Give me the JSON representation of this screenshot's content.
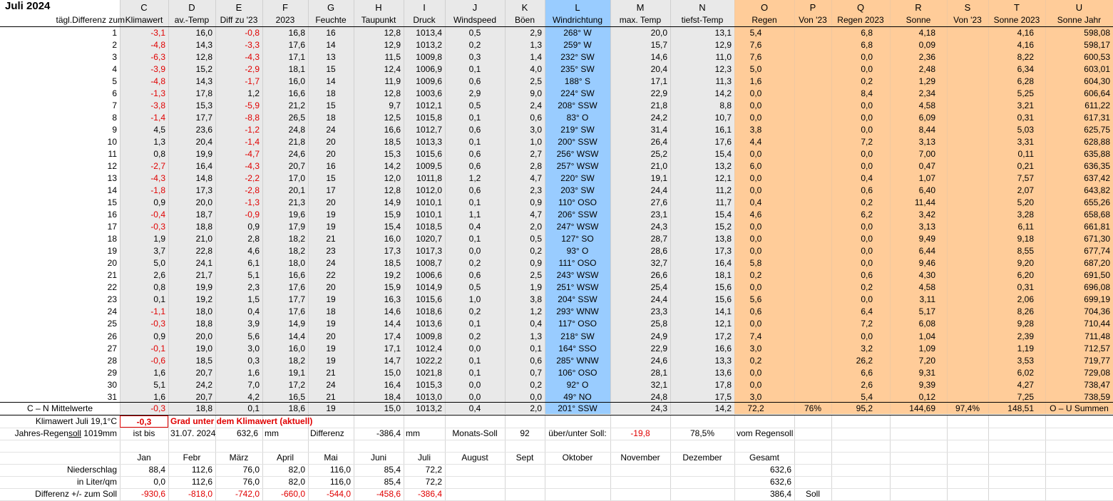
{
  "title": "Juli 2024",
  "row_label_header": "tägl.Differenz zum",
  "columns": [
    {
      "letter": "C",
      "name": "Klimawert"
    },
    {
      "letter": "D",
      "name": "av.-Temp"
    },
    {
      "letter": "E",
      "name": "Diff zu '23"
    },
    {
      "letter": "F",
      "name": "2023"
    },
    {
      "letter": "G",
      "name": "Feuchte"
    },
    {
      "letter": "H",
      "name": "Taupunkt"
    },
    {
      "letter": "I",
      "name": "Druck"
    },
    {
      "letter": "J",
      "name": "Windspeed"
    },
    {
      "letter": "K",
      "name": "Böen"
    },
    {
      "letter": "L",
      "name": "Windrichtung"
    },
    {
      "letter": "M",
      "name": "max. Temp"
    },
    {
      "letter": "N",
      "name": "tiefst-Temp"
    },
    {
      "letter": "O",
      "name": "Regen"
    },
    {
      "letter": "P",
      "name": "Von '23"
    },
    {
      "letter": "Q",
      "name": "Regen 2023"
    },
    {
      "letter": "R",
      "name": "Sonne"
    },
    {
      "letter": "S",
      "name": "Von '23"
    },
    {
      "letter": "T",
      "name": "Sonne 2023"
    },
    {
      "letter": "U",
      "name": "Sonne Jahr"
    }
  ],
  "rows": [
    {
      "day": "1",
      "c": "-3,1",
      "d": "16,0",
      "e": "-0,8",
      "f": "16,8",
      "g": "16",
      "h": "12,8",
      "i": "1013,4",
      "j": "0,5",
      "k": "2,9",
      "l": "268° W",
      "m": "20,0",
      "n": "13,1",
      "o": "5,4",
      "p": "",
      "q": "6,8",
      "r": "4,18",
      "s": "",
      "t": "4,16",
      "u": "598,08"
    },
    {
      "day": "2",
      "c": "-4,8",
      "d": "14,3",
      "e": "-3,3",
      "f": "17,6",
      "g": "14",
      "h": "12,9",
      "i": "1013,2",
      "j": "0,2",
      "k": "1,3",
      "l": "259° W",
      "m": "15,7",
      "n": "12,9",
      "o": "7,6",
      "p": "",
      "q": "6,8",
      "r": "0,09",
      "s": "",
      "t": "4,16",
      "u": "598,17"
    },
    {
      "day": "3",
      "c": "-6,3",
      "d": "12,8",
      "e": "-4,3",
      "f": "17,1",
      "g": "13",
      "h": "11,5",
      "i": "1009,8",
      "j": "0,3",
      "k": "1,4",
      "l": "232° SW",
      "m": "14,6",
      "n": "11,0",
      "o": "7,6",
      "p": "",
      "q": "0,0",
      "r": "2,36",
      "s": "",
      "t": "8,22",
      "u": "600,53"
    },
    {
      "day": "4",
      "c": "-3,9",
      "d": "15,2",
      "e": "-2,9",
      "f": "18,1",
      "g": "15",
      "h": "12,4",
      "i": "1006,9",
      "j": "0,1",
      "k": "4,0",
      "l": "235° SW",
      "m": "20,4",
      "n": "12,3",
      "o": "5,0",
      "p": "",
      "q": "0,0",
      "r": "2,48",
      "s": "",
      "t": "6,34",
      "u": "603,01"
    },
    {
      "day": "5",
      "c": "-4,8",
      "d": "14,3",
      "e": "-1,7",
      "f": "16,0",
      "g": "14",
      "h": "11,9",
      "i": "1009,6",
      "j": "0,6",
      "k": "2,5",
      "l": "188° S",
      "m": "17,1",
      "n": "11,3",
      "o": "1,6",
      "p": "",
      "q": "0,2",
      "r": "1,29",
      "s": "",
      "t": "6,28",
      "u": "604,30"
    },
    {
      "day": "6",
      "c": "-1,3",
      "d": "17,8",
      "e": "1,2",
      "f": "16,6",
      "g": "18",
      "h": "12,8",
      "i": "1003,6",
      "j": "2,9",
      "k": "9,0",
      "l": "224° SW",
      "m": "22,9",
      "n": "14,2",
      "o": "0,0",
      "p": "",
      "q": "8,4",
      "r": "2,34",
      "s": "",
      "t": "5,25",
      "u": "606,64"
    },
    {
      "day": "7",
      "c": "-3,8",
      "d": "15,3",
      "e": "-5,9",
      "f": "21,2",
      "g": "15",
      "h": "9,7",
      "i": "1012,1",
      "j": "0,5",
      "k": "2,4",
      "l": "208° SSW",
      "m": "21,8",
      "n": "8,8",
      "o": "0,0",
      "p": "",
      "q": "0,0",
      "r": "4,58",
      "s": "",
      "t": "3,21",
      "u": "611,22"
    },
    {
      "day": "8",
      "c": "-1,4",
      "d": "17,7",
      "e": "-8,8",
      "f": "26,5",
      "g": "18",
      "h": "12,5",
      "i": "1015,8",
      "j": "0,1",
      "k": "0,6",
      "l": "83° O",
      "m": "24,2",
      "n": "10,7",
      "o": "0,0",
      "p": "",
      "q": "0,0",
      "r": "6,09",
      "s": "",
      "t": "0,31",
      "u": "617,31"
    },
    {
      "day": "9",
      "c": "4,5",
      "d": "23,6",
      "e": "-1,2",
      "f": "24,8",
      "g": "24",
      "h": "16,6",
      "i": "1012,7",
      "j": "0,6",
      "k": "3,0",
      "l": "219° SW",
      "m": "31,4",
      "n": "16,1",
      "o": "3,8",
      "p": "",
      "q": "0,0",
      "r": "8,44",
      "s": "",
      "t": "5,03",
      "u": "625,75"
    },
    {
      "day": "10",
      "c": "1,3",
      "d": "20,4",
      "e": "-1,4",
      "f": "21,8",
      "g": "20",
      "h": "18,5",
      "i": "1013,3",
      "j": "0,1",
      "k": "1,0",
      "l": "200° SSW",
      "m": "26,4",
      "n": "17,6",
      "o": "4,4",
      "p": "",
      "q": "7,2",
      "r": "3,13",
      "s": "",
      "t": "3,31",
      "u": "628,88"
    },
    {
      "day": "11",
      "c": "0,8",
      "d": "19,9",
      "e": "-4,7",
      "f": "24,6",
      "g": "20",
      "h": "15,3",
      "i": "1015,6",
      "j": "0,6",
      "k": "2,7",
      "l": "256° WSW",
      "m": "25,2",
      "n": "15,4",
      "o": "0,0",
      "p": "",
      "q": "0,0",
      "r": "7,00",
      "s": "",
      "t": "0,11",
      "u": "635,88"
    },
    {
      "day": "12",
      "c": "-2,7",
      "d": "16,4",
      "e": "-4,3",
      "f": "20,7",
      "g": "16",
      "h": "14,2",
      "i": "1009,5",
      "j": "0,6",
      "k": "2,8",
      "l": "257° WSW",
      "m": "21,0",
      "n": "13,2",
      "o": "6,0",
      "p": "",
      "q": "0,0",
      "r": "0,47",
      "s": "",
      "t": "0,21",
      "u": "636,35"
    },
    {
      "day": "13",
      "c": "-4,3",
      "d": "14,8",
      "e": "-2,2",
      "f": "17,0",
      "g": "15",
      "h": "12,0",
      "i": "1011,8",
      "j": "1,2",
      "k": "4,7",
      "l": "220° SW",
      "m": "19,1",
      "n": "12,1",
      "o": "0,0",
      "p": "",
      "q": "0,4",
      "r": "1,07",
      "s": "",
      "t": "7,57",
      "u": "637,42"
    },
    {
      "day": "14",
      "c": "-1,8",
      "d": "17,3",
      "e": "-2,8",
      "f": "20,1",
      "g": "17",
      "h": "12,8",
      "i": "1012,0",
      "j": "0,6",
      "k": "2,3",
      "l": "203° SW",
      "m": "24,4",
      "n": "11,2",
      "o": "0,0",
      "p": "",
      "q": "0,6",
      "r": "6,40",
      "s": "",
      "t": "2,07",
      "u": "643,82"
    },
    {
      "day": "15",
      "c": "0,9",
      "d": "20,0",
      "e": "-1,3",
      "f": "21,3",
      "g": "20",
      "h": "14,9",
      "i": "1010,1",
      "j": "0,1",
      "k": "0,9",
      "l": "110° OSO",
      "m": "27,6",
      "n": "11,7",
      "o": "0,4",
      "p": "",
      "q": "0,2",
      "r": "11,44",
      "s": "",
      "t": "5,20",
      "u": "655,26"
    },
    {
      "day": "16",
      "c": "-0,4",
      "d": "18,7",
      "e": "-0,9",
      "f": "19,6",
      "g": "19",
      "h": "15,9",
      "i": "1010,1",
      "j": "1,1",
      "k": "4,7",
      "l": "206° SSW",
      "m": "23,1",
      "n": "15,4",
      "o": "4,6",
      "p": "",
      "q": "6,2",
      "r": "3,42",
      "s": "",
      "t": "3,28",
      "u": "658,68"
    },
    {
      "day": "17",
      "c": "-0,3",
      "d": "18,8",
      "e": "0,9",
      "f": "17,9",
      "g": "19",
      "h": "15,4",
      "i": "1018,5",
      "j": "0,4",
      "k": "2,0",
      "l": "247° WSW",
      "m": "24,3",
      "n": "15,2",
      "o": "0,0",
      "p": "",
      "q": "0,0",
      "r": "3,13",
      "s": "",
      "t": "6,11",
      "u": "661,81"
    },
    {
      "day": "18",
      "c": "1,9",
      "d": "21,0",
      "e": "2,8",
      "f": "18,2",
      "g": "21",
      "h": "16,0",
      "i": "1020,7",
      "j": "0,1",
      "k": "0,5",
      "l": "127° SO",
      "m": "28,7",
      "n": "13,8",
      "o": "0,0",
      "p": "",
      "q": "0,0",
      "r": "9,49",
      "s": "",
      "t": "9,18",
      "u": "671,30"
    },
    {
      "day": "19",
      "c": "3,7",
      "d": "22,8",
      "e": "4,6",
      "f": "18,2",
      "g": "23",
      "h": "17,3",
      "i": "1017,3",
      "j": "0,0",
      "k": "0,2",
      "l": "93° O",
      "m": "28,6",
      "n": "17,3",
      "o": "0,0",
      "p": "",
      "q": "0,0",
      "r": "6,44",
      "s": "",
      "t": "8,55",
      "u": "677,74"
    },
    {
      "day": "20",
      "c": "5,0",
      "d": "24,1",
      "e": "6,1",
      "f": "18,0",
      "g": "24",
      "h": "18,5",
      "i": "1008,7",
      "j": "0,2",
      "k": "0,9",
      "l": "111° OSO",
      "m": "32,7",
      "n": "16,4",
      "o": "5,8",
      "p": "",
      "q": "0,0",
      "r": "9,46",
      "s": "",
      "t": "9,20",
      "u": "687,20"
    },
    {
      "day": "21",
      "c": "2,6",
      "d": "21,7",
      "e": "5,1",
      "f": "16,6",
      "g": "22",
      "h": "19,2",
      "i": "1006,6",
      "j": "0,6",
      "k": "2,5",
      "l": "243° WSW",
      "m": "26,6",
      "n": "18,1",
      "o": "0,2",
      "p": "",
      "q": "0,6",
      "r": "4,30",
      "s": "",
      "t": "6,20",
      "u": "691,50"
    },
    {
      "day": "22",
      "c": "0,8",
      "d": "19,9",
      "e": "2,3",
      "f": "17,6",
      "g": "20",
      "h": "15,9",
      "i": "1014,9",
      "j": "0,5",
      "k": "1,9",
      "l": "251° WSW",
      "m": "25,4",
      "n": "15,6",
      "o": "0,0",
      "p": "",
      "q": "0,2",
      "r": "4,58",
      "s": "",
      "t": "0,31",
      "u": "696,08"
    },
    {
      "day": "23",
      "c": "0,1",
      "d": "19,2",
      "e": "1,5",
      "f": "17,7",
      "g": "19",
      "h": "16,3",
      "i": "1015,6",
      "j": "1,0",
      "k": "3,8",
      "l": "204° SSW",
      "m": "24,4",
      "n": "15,6",
      "o": "5,6",
      "p": "",
      "q": "0,0",
      "r": "3,11",
      "s": "",
      "t": "2,06",
      "u": "699,19"
    },
    {
      "day": "24",
      "c": "-1,1",
      "d": "18,0",
      "e": "0,4",
      "f": "17,6",
      "g": "18",
      "h": "14,6",
      "i": "1018,6",
      "j": "0,2",
      "k": "1,2",
      "l": "293° WNW",
      "m": "23,3",
      "n": "14,1",
      "o": "0,6",
      "p": "",
      "q": "6,4",
      "r": "5,17",
      "s": "",
      "t": "8,26",
      "u": "704,36"
    },
    {
      "day": "25",
      "c": "-0,3",
      "d": "18,8",
      "e": "3,9",
      "f": "14,9",
      "g": "19",
      "h": "14,4",
      "i": "1013,6",
      "j": "0,1",
      "k": "0,4",
      "l": "117° OSO",
      "m": "25,8",
      "n": "12,1",
      "o": "0,0",
      "p": "",
      "q": "7,2",
      "r": "6,08",
      "s": "",
      "t": "9,28",
      "u": "710,44"
    },
    {
      "day": "26",
      "c": "0,9",
      "d": "20,0",
      "e": "5,6",
      "f": "14,4",
      "g": "20",
      "h": "17,4",
      "i": "1009,8",
      "j": "0,2",
      "k": "1,3",
      "l": "218° SW",
      "m": "24,9",
      "n": "17,2",
      "o": "7,4",
      "p": "",
      "q": "0,0",
      "r": "1,04",
      "s": "",
      "t": "2,39",
      "u": "711,48"
    },
    {
      "day": "27",
      "c": "-0,1",
      "d": "19,0",
      "e": "3,0",
      "f": "16,0",
      "g": "19",
      "h": "17,1",
      "i": "1012,4",
      "j": "0,0",
      "k": "0,1",
      "l": "164° SSO",
      "m": "22,9",
      "n": "16,6",
      "o": "3,0",
      "p": "",
      "q": "3,2",
      "r": "1,09",
      "s": "",
      "t": "1,19",
      "u": "712,57"
    },
    {
      "day": "28",
      "c": "-0,6",
      "d": "18,5",
      "e": "0,3",
      "f": "18,2",
      "g": "19",
      "h": "14,7",
      "i": "1022,2",
      "j": "0,1",
      "k": "0,6",
      "l": "285° WNW",
      "m": "24,6",
      "n": "13,3",
      "o": "0,2",
      "p": "",
      "q": "26,2",
      "r": "7,20",
      "s": "",
      "t": "3,53",
      "u": "719,77"
    },
    {
      "day": "29",
      "c": "1,6",
      "d": "20,7",
      "e": "1,6",
      "f": "19,1",
      "g": "21",
      "h": "15,0",
      "i": "1021,8",
      "j": "0,1",
      "k": "0,7",
      "l": "106° OSO",
      "m": "28,1",
      "n": "13,6",
      "o": "0,0",
      "p": "",
      "q": "6,6",
      "r": "9,31",
      "s": "",
      "t": "6,02",
      "u": "729,08"
    },
    {
      "day": "30",
      "c": "5,1",
      "d": "24,2",
      "e": "7,0",
      "f": "17,2",
      "g": "24",
      "h": "16,4",
      "i": "1015,3",
      "j": "0,0",
      "k": "0,2",
      "l": "92° O",
      "m": "32,1",
      "n": "17,8",
      "o": "0,0",
      "p": "",
      "q": "2,6",
      "r": "9,39",
      "s": "",
      "t": "4,27",
      "u": "738,47"
    },
    {
      "day": "31",
      "c": "1,6",
      "d": "20,7",
      "e": "4,2",
      "f": "16,5",
      "g": "21",
      "h": "18,4",
      "i": "1013,0",
      "j": "0,0",
      "k": "0,0",
      "l": "49° NO",
      "m": "24,8",
      "n": "17,5",
      "o": "3,0",
      "p": "",
      "q": "5,4",
      "r": "0,12",
      "s": "",
      "t": "7,25",
      "u": "738,59"
    }
  ],
  "means": {
    "label": "C – N Mittelwerte",
    "c": "-0,3",
    "d": "18,8",
    "e": "0,1",
    "f": "18,6",
    "g": "19",
    "h": "15,0",
    "i": "1013,2",
    "j": "0,4",
    "k": "2,0",
    "l": "201° SSW",
    "m": "24,3",
    "n": "14,2",
    "o": "72,2",
    "p": "76%",
    "q": "95,2",
    "r": "144,69",
    "s": "97,4%",
    "t": "148,51",
    "u": "O – U Summen"
  },
  "klimawert": {
    "label": "Klimawert Juli 19,1°C",
    "value": "-0,3",
    "note": "Grad unter dem Klimawert (aktuell)"
  },
  "regensoll": {
    "label": "Jahres-Regensoll 1019mm",
    "label_pre": "Jahres-Regen",
    "label_underlined": "soll",
    "label_post": " 1019mm",
    "ist_bis": "ist bis",
    "date": "31.07. 2024",
    "amount": "632,6",
    "unit": "mm",
    "diff_label": "Differenz",
    "diff_value": "-386,4",
    "diff_unit": "mm",
    "monats_soll_label": "Monats-Soll",
    "monats_soll_value": "92",
    "ueber_unter_label": "über/unter Soll:",
    "ueber_unter_value": "-19,8",
    "percent": "78,5%",
    "vom_regensoll": "vom Regensoll"
  },
  "monthly": {
    "months": [
      "Jan",
      "Febr",
      "März",
      "April",
      "Mai",
      "Juni",
      "Juli",
      "August",
      "Sept",
      "Oktober",
      "November",
      "Dezember",
      "Gesamt"
    ],
    "rows": [
      {
        "label": "Niederschlag",
        "values": [
          "88,4",
          "112,6",
          "76,0",
          "82,0",
          "116,0",
          "85,4",
          "72,2",
          "",
          "",
          "",
          "",
          "",
          "632,6"
        ],
        "extra": ""
      },
      {
        "label": "in Liter/qm",
        "values": [
          "0,0",
          "112,6",
          "76,0",
          "82,0",
          "116,0",
          "85,4",
          "72,2",
          "",
          "",
          "",
          "",
          "",
          "632,6"
        ],
        "extra": ""
      },
      {
        "label": "Differenz  +/- zum Soll",
        "values": [
          "-930,6",
          "-818,0",
          "-742,0",
          "-660,0",
          "-544,0",
          "-458,6",
          "-386,4",
          "",
          "",
          "",
          "",
          "",
          "386,4"
        ],
        "extra": "Soll"
      }
    ]
  },
  "colors": {
    "grey_band": "#e9e9e9",
    "blue_band": "#99ccff",
    "orange_band": "#ffcc99",
    "red_text": "#e00000"
  }
}
